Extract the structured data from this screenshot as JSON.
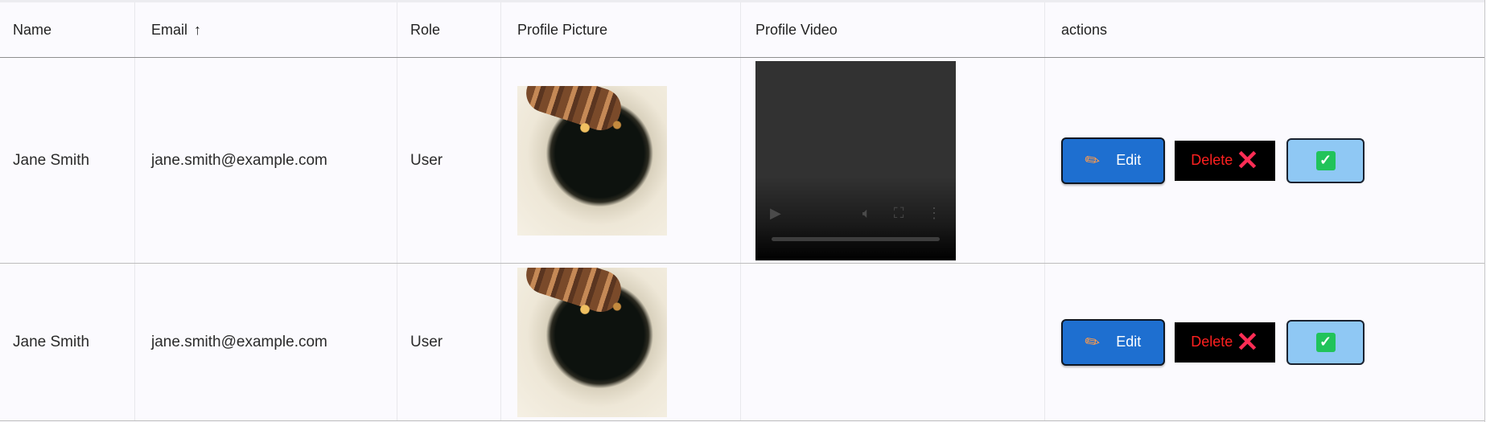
{
  "table": {
    "headers": {
      "name": "Name",
      "email": "Email",
      "role": "Role",
      "profile_picture": "Profile Picture",
      "profile_video": "Profile Video",
      "actions": "actions"
    },
    "sort_icon": "arrow-up-icon",
    "rows": [
      {
        "name": "Jane Smith",
        "email": "jane.smith@example.com",
        "role": "User",
        "has_picture": true,
        "has_video": true
      },
      {
        "name": "Jane Smith",
        "email": "jane.smith@example.com",
        "role": "User",
        "has_picture": true,
        "has_video": false
      }
    ]
  },
  "actions": {
    "edit_label": "Edit",
    "delete_label": "Delete",
    "edit_icon": "pencil-icon",
    "delete_icon": "close-icon",
    "confirm_icon": "checkbox-checked-icon"
  },
  "colors": {
    "edit_bg": "#1e6fd0",
    "delete_bg": "#000000",
    "delete_text": "#ff2020",
    "confirm_bg": "#8fc8f4",
    "check_bg": "#21c35a"
  }
}
